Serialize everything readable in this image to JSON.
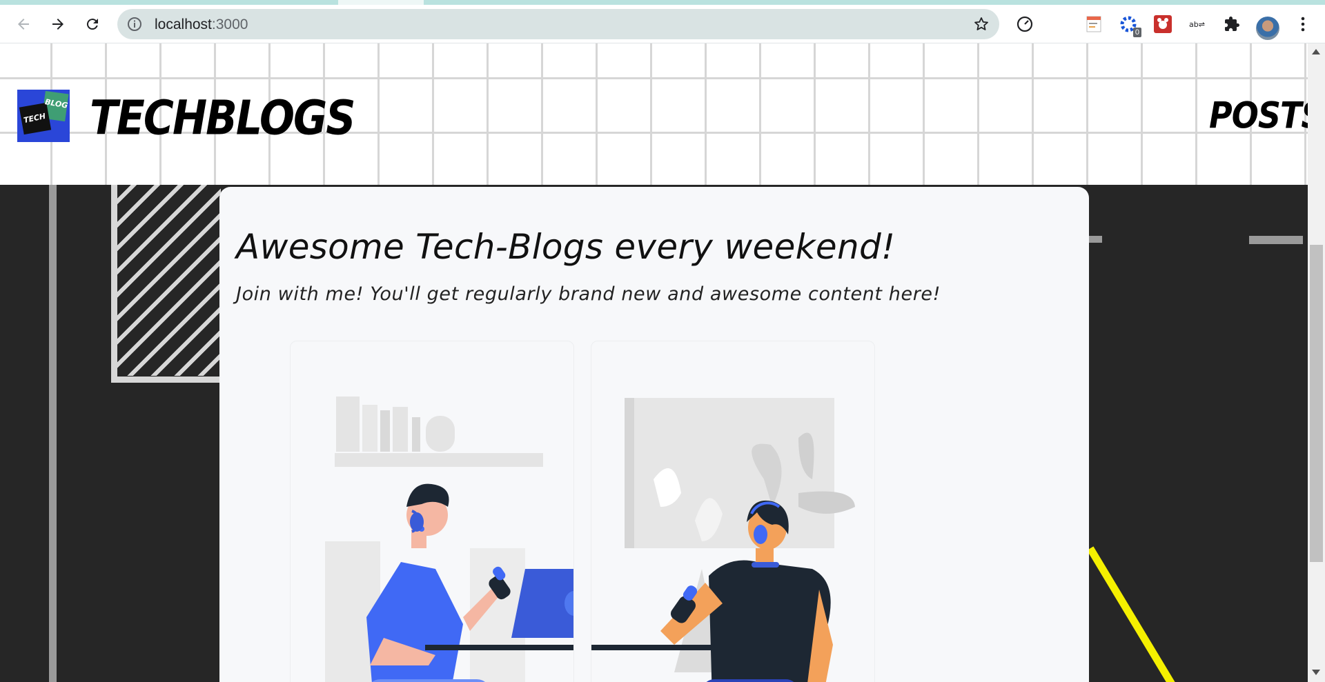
{
  "browser": {
    "url_host": "localhost",
    "url_port": ":3000",
    "extensions": [
      "speed-dial-icon",
      "notes-extension-icon",
      "gear-extension-icon",
      "bug-extension-icon",
      "translate-extension-icon",
      "puzzle-icon"
    ],
    "extension_badge": "0"
  },
  "header": {
    "logo_text_top": "BLOG",
    "logo_text_bottom": "TECH",
    "brand": "TECHBLOGS",
    "nav_posts": "POSTS"
  },
  "hero": {
    "headline": "Awesome Tech-Blogs every weekend!",
    "subline": "Join with me! You'll get regularly brand new and awesome content here!"
  },
  "illustrations": [
    "podcast-host-illustration",
    "podcast-guest-illustration"
  ],
  "colors": {
    "accent_blue": "#4069f5",
    "dark_bg": "#262626",
    "card_bg": "#f7f8fa",
    "omnibox": "#d9e3e3",
    "tab_strip": "#b9e2df"
  }
}
